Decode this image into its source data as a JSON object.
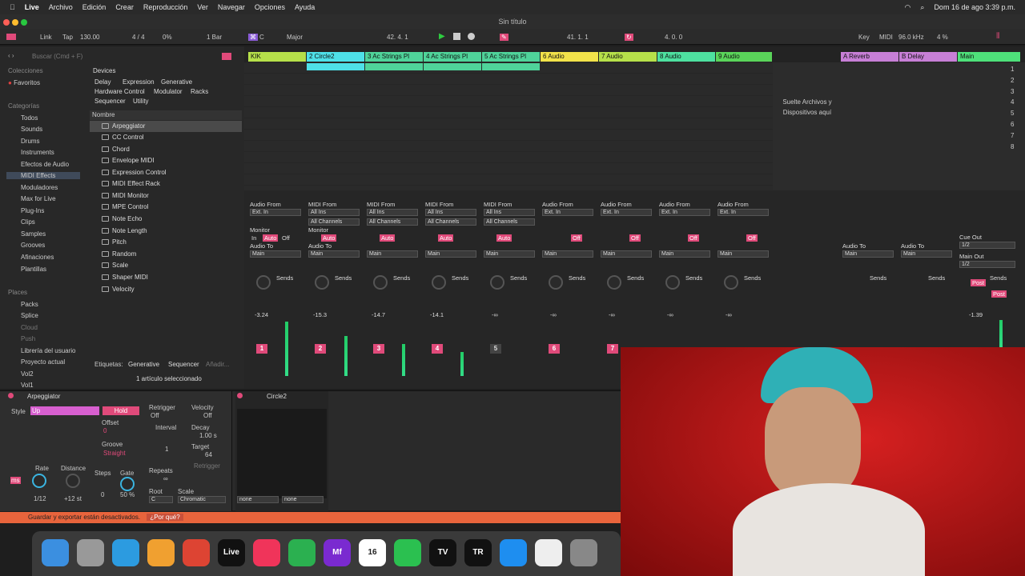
{
  "menubar": {
    "app": "Live",
    "items": [
      "Archivo",
      "Edición",
      "Crear",
      "Reproducción",
      "Ver",
      "Navegar",
      "Opciones",
      "Ayuda"
    ],
    "clock": "Dom 16 de ago  3:39 p.m."
  },
  "window": {
    "title": "Sin título"
  },
  "transport": {
    "link": "Link",
    "tap": "Tap",
    "tempo": "130.00",
    "signature": "4 / 4",
    "cpu": "0%",
    "quant": "1 Bar",
    "key": "C",
    "scale": "Major",
    "position": "42.  4.  1",
    "loop_start": "41.  1.  1",
    "loop_len": "4.  0.  0",
    "key_label": "Key",
    "midi_label": "MIDI",
    "sample_rate": "96.0 kHz",
    "cpu_pct": "4 %"
  },
  "browser": {
    "search_placeholder": "Buscar (Cmd + F)",
    "collections_header": "Colecciones",
    "favorites": "Favoritos",
    "categories_header": "Categorías",
    "categories": [
      "Todos",
      "Sounds",
      "Drums",
      "Instruments",
      "Efectos de Audio",
      "MIDI Effects",
      "Moduladores",
      "Max for Live",
      "Plug-Ins",
      "Clips",
      "Samples",
      "Grooves",
      "Afinaciones",
      "Plantillas"
    ],
    "places_header": "Places",
    "places": [
      "Packs",
      "Splice",
      "Cloud",
      "Push",
      "Librería del usuario",
      "Proyecto actual",
      "Vol2",
      "Vol1"
    ],
    "devices_label": "Devices",
    "filters": [
      "Delay",
      "Expression",
      "Generative",
      "Hardware Control",
      "Modulator",
      "Racks",
      "Sequencer",
      "Utility"
    ],
    "column_header": "Nombre",
    "items": [
      "Arpeggiator",
      "CC Control",
      "Chord",
      "Envelope MIDI",
      "Expression Control",
      "MIDI Effect Rack",
      "MIDI Monitor",
      "MPE Control",
      "Note Echo",
      "Note Length",
      "Pitch",
      "Random",
      "Scale",
      "Shaper MIDI",
      "Velocity"
    ],
    "tags_label": "Etiquetas:",
    "tags": [
      "Generative",
      "Sequencer",
      "Añadir..."
    ],
    "selection_status": "1 artículo seleccionado"
  },
  "tracks": [
    {
      "name": "KIK",
      "color": "#b6e04a",
      "num": "1",
      "vol": "-3.24"
    },
    {
      "name": "2 Circle2",
      "color": "#4ee0e8",
      "num": "2",
      "vol": "-15.3"
    },
    {
      "name": "3 Ac Strings Pl",
      "color": "#4fd39a",
      "num": "3",
      "vol": "-14.7"
    },
    {
      "name": "4 Ac Strings Pl",
      "color": "#4fd39a",
      "num": "4",
      "vol": "-14.1"
    },
    {
      "name": "5 Ac Strings Pl",
      "color": "#4fd39a",
      "num": "5",
      "vol": "-∞"
    },
    {
      "name": "6 Audio",
      "color": "#f2e24a",
      "num": "6",
      "vol": "-∞"
    },
    {
      "name": "7 Audio",
      "color": "#b6e04a",
      "num": "7",
      "vol": "-∞"
    },
    {
      "name": "8 Audio",
      "color": "#4ee0a0",
      "num": "8",
      "vol": "-∞"
    },
    {
      "name": "9 Audio",
      "color": "#5ad45a",
      "num": "9",
      "vol": "-∞"
    }
  ],
  "returns": [
    {
      "name": "A Reverb",
      "color": "#c77fd6"
    },
    {
      "name": "B Delay",
      "color": "#c77fd6"
    },
    {
      "name": "Main",
      "color": "#4ee07a"
    }
  ],
  "drop_hint": "Suelte Archivos y Dispositivos aquí",
  "mixer": {
    "audio_from": "Audio From",
    "midi_from": "MIDI From",
    "ext_in": "Ext. In",
    "all_ins": "All Ins",
    "all_channels": "All Channels",
    "monitor": "Monitor",
    "in": "In",
    "auto": "Auto",
    "off": "Off",
    "audio_to": "Audio To",
    "main": "Main",
    "sends": "Sends",
    "cue_out": "Cue Out",
    "main_out": "Main Out",
    "ch12": "1/2",
    "master_vol": "-1.39",
    "post": "Post"
  },
  "scene_numbers": [
    "1",
    "2",
    "3",
    "4",
    "5",
    "6",
    "7",
    "8"
  ],
  "arpeggiator": {
    "title": "Arpeggiator",
    "style_label": "Style",
    "style": "Up",
    "hold": "Hold",
    "offset_label": "Offset",
    "offset": "0",
    "groove_label": "Groove",
    "groove": "Straight",
    "retrigger_label": "Retrigger",
    "retrigger": "Off",
    "interval_label": "Interval",
    "interval": "1",
    "repeats_label": "Repeats",
    "repeats": "∞",
    "velocity_label": "Velocity",
    "velocity": "Off",
    "decay_label": "Decay",
    "decay": "1.00 s",
    "target_label": "Target",
    "target": "64",
    "retrigger_btn": "Retrigger",
    "rate_label": "Rate",
    "rate": "1/12",
    "distance_label": "Distance",
    "distance": "+12 st",
    "steps_label": "Steps",
    "steps": "0",
    "gate_label": "Gate",
    "gate": "50 %",
    "root_label": "Root",
    "root": "C",
    "scale_label": "Scale",
    "scale": "Chromatic",
    "ms": "ms"
  },
  "instrument": {
    "title": "Circle2",
    "none1": "none",
    "none2": "none"
  },
  "status": {
    "message": "Guardar y exportar están desactivados.",
    "link": "¿Por qué?"
  },
  "dock": [
    "Finder",
    "Launchpad",
    "Safari",
    "Photos",
    "Chrome",
    "Live",
    "Music",
    "Messages",
    "Mf",
    "16",
    "FaceTime",
    "TV",
    "TR",
    "App Store",
    "Notes",
    "Settings"
  ]
}
